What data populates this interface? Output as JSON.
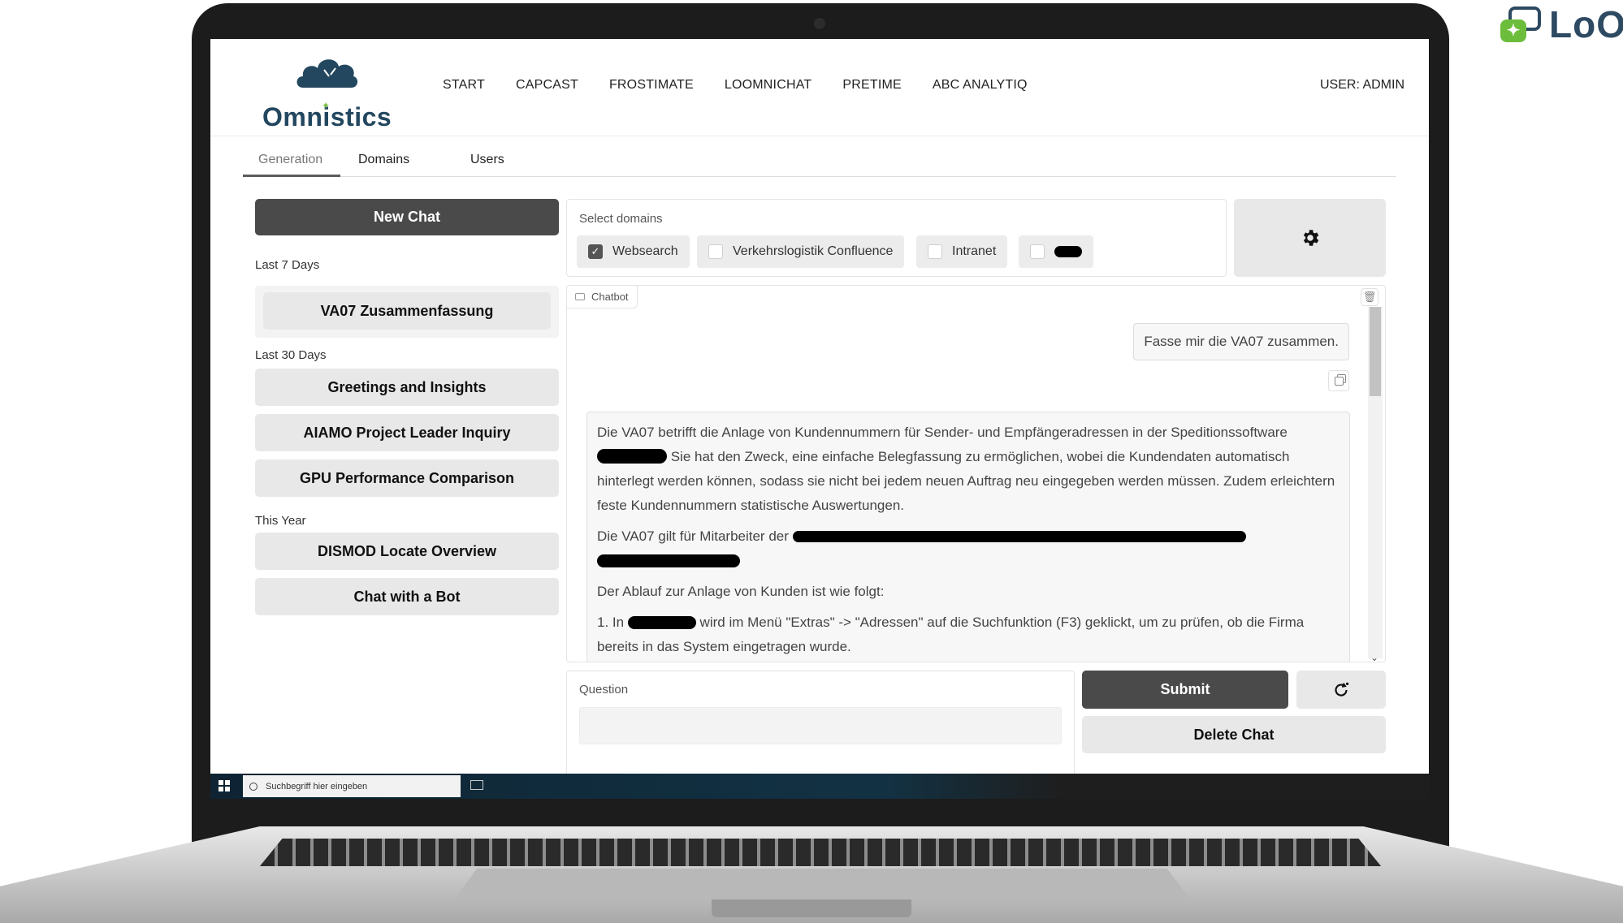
{
  "brand_corner": {
    "text": "LoO"
  },
  "header": {
    "logo_text": "Omnistics",
    "nav": [
      "START",
      "CAPCAST",
      "FROSTIMATE",
      "LOOMNICHAT",
      "PRETIME",
      "ABC ANALYTIQ"
    ],
    "user": "USER: ADMIN"
  },
  "tabs": [
    "Generation",
    "Domains",
    "Users"
  ],
  "sidebar": {
    "new_chat": "New Chat",
    "groups": [
      {
        "label": "Last 7 Days",
        "items": [
          "VA07 Zusammenfassung"
        ]
      },
      {
        "label": "Last 30 Days",
        "items": [
          "Greetings and Insights",
          "AIAMO Project Leader Inquiry",
          "GPU Performance Comparison"
        ]
      },
      {
        "label": "This Year",
        "items": [
          "DISMOD Locate Overview",
          "Chat with a Bot"
        ]
      }
    ]
  },
  "domains": {
    "label": "Select domains",
    "options": [
      {
        "label": "Websearch",
        "checked": true
      },
      {
        "label": "Verkehrslogistik Confluence",
        "checked": false
      },
      {
        "label": "Intranet",
        "checked": false
      },
      {
        "label": "",
        "checked": false
      }
    ]
  },
  "chatbot": {
    "tag": "Chatbot",
    "user_message": "Fasse mir die VA07 zusammen.",
    "bot_paragraphs": [
      [
        "Die VA07 betrifft die Anlage von Kundennummern für Sender- und Empfängeradressen in der Speditionssoftware",
        " Sie hat den Zweck, eine einfache Belegfassung zu ermöglichen, wobei die Kundendaten automatisch hinterlegt werden können, sodass sie nicht bei jedem neuen Auftrag neu eingegeben werden müssen. Zudem erleichtern feste Kundennummern statistische Auswertungen."
      ],
      [
        "Die VA07 gilt für Mitarbeiter der"
      ],
      [
        "Der Ablauf zur Anlage von Kunden ist wie folgt:"
      ],
      [
        "1. In",
        " wird im Menü \"Extras\" -> \"Adressen\" auf die Suchfunktion (F3) geklickt, um zu prüfen, ob die Firma bereits in das System eingetragen wurde."
      ]
    ]
  },
  "question": {
    "label": "Question",
    "placeholder": ""
  },
  "actions": {
    "submit": "Submit",
    "delete": "Delete Chat"
  },
  "taskbar": {
    "search_placeholder": "Suchbegriff hier eingeben"
  }
}
